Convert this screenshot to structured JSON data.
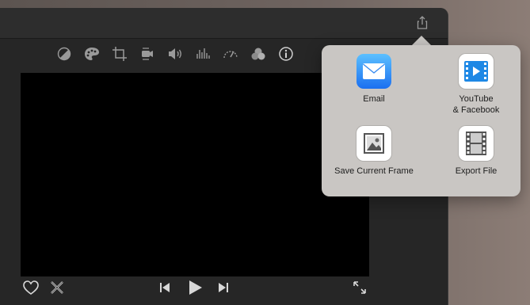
{
  "icons": {
    "share": "share-icon",
    "toolbar": [
      "color-balance-icon",
      "color-correction-palette-icon",
      "crop-icon",
      "stabilization-camera-icon",
      "volume-icon",
      "equalizer-icon",
      "speed-icon",
      "clip-filter-icon",
      "info-icon"
    ],
    "bottom": [
      "heart-icon",
      "reject-x-icon",
      "skip-back-icon",
      "play-icon",
      "skip-forward-icon",
      "fullscreen-icon"
    ]
  },
  "share_menu": {
    "items": [
      {
        "label": "Email",
        "icon": "mail-icon"
      },
      {
        "label": "YouTube\n& Facebook",
        "icon": "video-play-icon"
      },
      {
        "label": "Save Current Frame",
        "icon": "image-frame-icon"
      },
      {
        "label": "Export File",
        "icon": "film-strip-icon"
      }
    ]
  },
  "colors": {
    "window_bg": "#262626",
    "viewer_bg": "#000000",
    "popover_bg": "#c9c6c3",
    "icon_gray": "#9a9a9a",
    "email_blue": "#1a6ff0",
    "youtube_blue": "#1e88e5"
  }
}
